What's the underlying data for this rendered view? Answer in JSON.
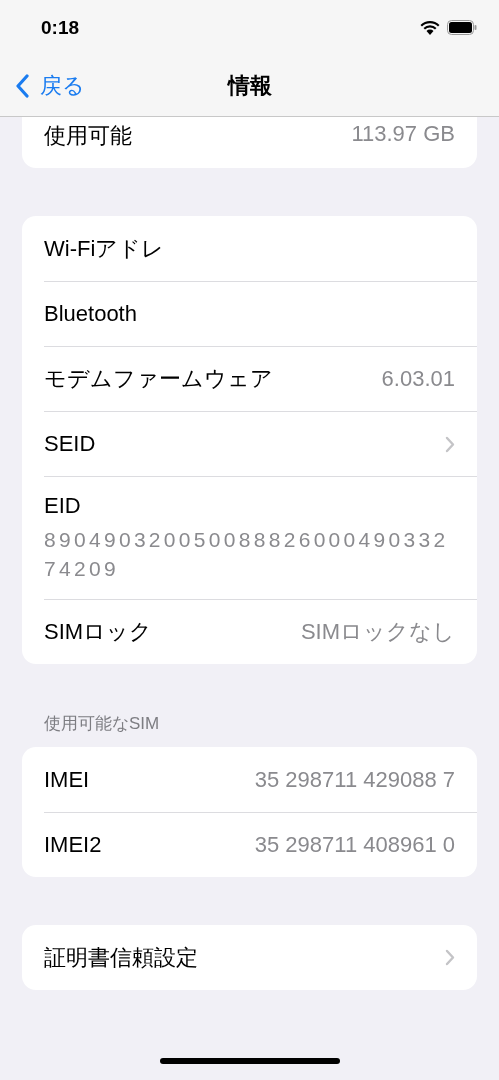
{
  "status_bar": {
    "time": "0:18"
  },
  "nav": {
    "back": "戻る",
    "title": "情報"
  },
  "groups": [
    {
      "cut_top": true,
      "rows": [
        {
          "kind": "value",
          "label": "使用可能",
          "value": "113.97 GB"
        }
      ]
    },
    {
      "rows": [
        {
          "kind": "plain",
          "label": "Wi-Fiアドレ"
        },
        {
          "kind": "plain",
          "label": "Bluetooth"
        },
        {
          "kind": "value",
          "label": "モデムファームウェア",
          "value": "6.03.01"
        },
        {
          "kind": "link",
          "label": "SEID"
        },
        {
          "kind": "stacked",
          "label": "EID",
          "value": "89049032005008882600049033274209"
        },
        {
          "kind": "value",
          "label": "SIMロック",
          "value": "SIMロックなし"
        }
      ]
    },
    {
      "header": "使用可能なSIM",
      "rows": [
        {
          "kind": "value",
          "label": "IMEI",
          "value": "35 298711 429088 7"
        },
        {
          "kind": "value",
          "label": "IMEI2",
          "value": "35 298711 408961 0"
        }
      ]
    },
    {
      "rows": [
        {
          "kind": "link",
          "label": "証明書信頼設定"
        }
      ]
    }
  ]
}
